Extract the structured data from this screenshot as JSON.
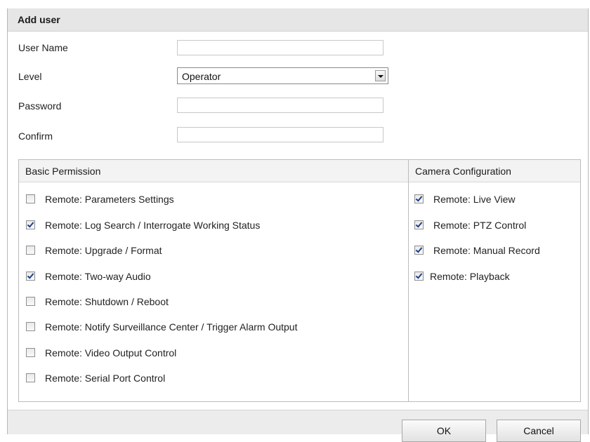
{
  "dialog": {
    "title": "Add user"
  },
  "form": {
    "user_name": {
      "label": "User Name",
      "value": "",
      "placeholder": ""
    },
    "level": {
      "label": "Level",
      "value": "Operator"
    },
    "password": {
      "label": "Password",
      "value": "",
      "placeholder": ""
    },
    "confirm": {
      "label": "Confirm",
      "value": "",
      "placeholder": ""
    }
  },
  "permissions": {
    "basic": {
      "header": "Basic Permission",
      "items": [
        {
          "label": "Remote: Parameters Settings",
          "checked": false
        },
        {
          "label": "Remote: Log Search / Interrogate Working Status",
          "checked": true
        },
        {
          "label": "Remote: Upgrade / Format",
          "checked": false
        },
        {
          "label": "Remote: Two-way Audio",
          "checked": true
        },
        {
          "label": "Remote: Shutdown / Reboot",
          "checked": false
        },
        {
          "label": "Remote: Notify Surveillance Center / Trigger Alarm Output",
          "checked": false
        },
        {
          "label": "Remote: Video Output Control",
          "checked": false
        },
        {
          "label": "Remote: Serial Port Control",
          "checked": false
        }
      ]
    },
    "camera": {
      "header": "Camera Configuration",
      "items": [
        {
          "label": "Remote: Live View",
          "checked": true
        },
        {
          "label": "Remote: PTZ Control",
          "checked": true
        },
        {
          "label": "Remote: Manual Record",
          "checked": true
        },
        {
          "label": "Remote: Playback",
          "checked": true
        }
      ]
    }
  },
  "footer": {
    "ok_label": "OK",
    "cancel_label": "Cancel"
  }
}
